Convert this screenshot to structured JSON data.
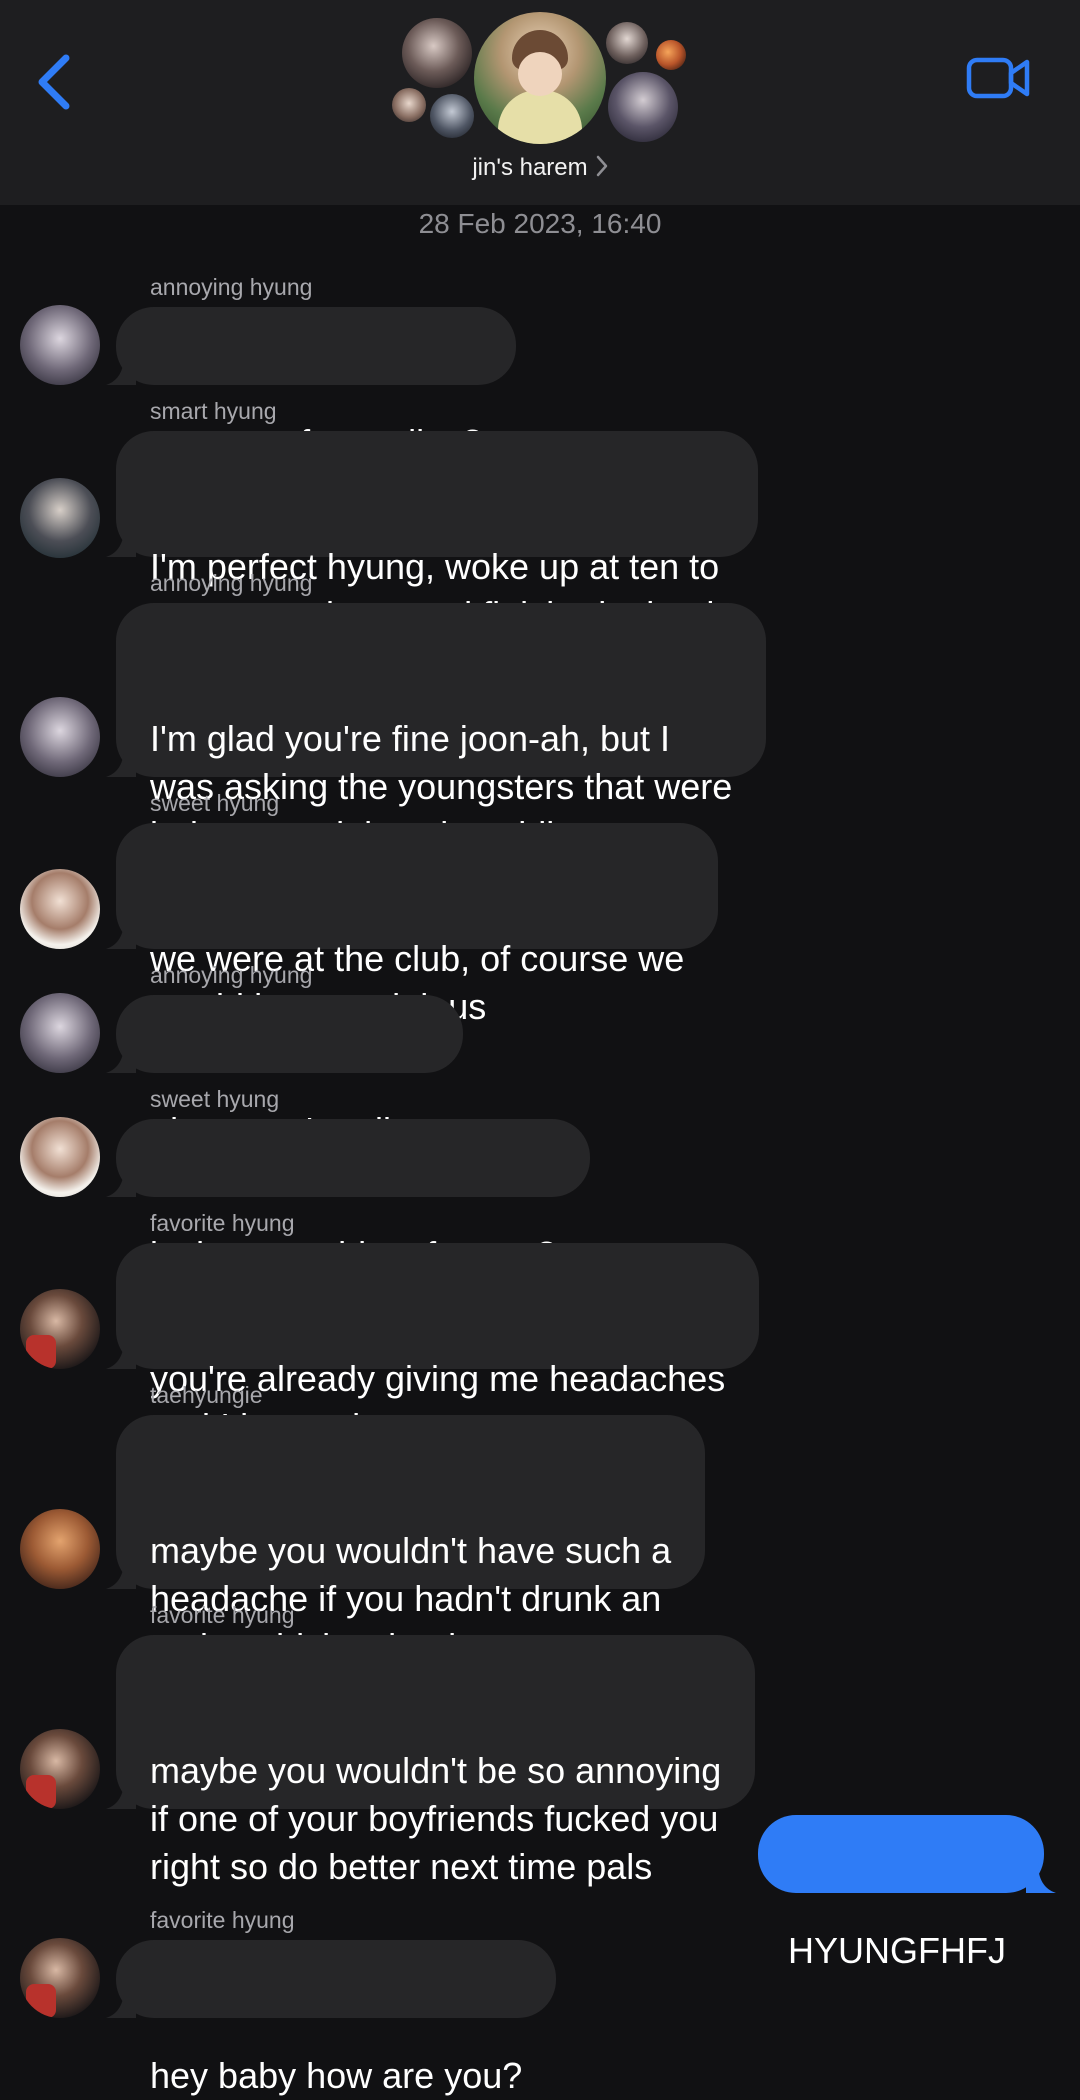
{
  "header": {
    "group_name": "jin's harem",
    "colors": {
      "accent": "#2f7cf6",
      "background": "#1e1e20"
    },
    "icons": {
      "back": "chevron-left-icon",
      "video": "video-camera-icon",
      "group_chevron": "chevron-right-icon"
    }
  },
  "timestamp": "28 Feb 2023, 16:40",
  "messages": [
    {
      "sender": "annoying hyung",
      "text": "are any of you alive?"
    },
    {
      "sender": "smart hyung",
      "text": "I'm perfect hyung, woke up at ten to\nwater my plants and finished a book"
    },
    {
      "sender": "annoying hyung",
      "text": "I'm glad you're fine joon-ah, but I\nwas asking the youngsters that were\nbeing scandalous in public spaces"
    },
    {
      "sender": "sweet hyung",
      "text": "we were at the club, of course we\nwould be scandalous"
    },
    {
      "sender": "annoying hyung",
      "text": "oh so you're alive"
    },
    {
      "sender": "sweet hyung",
      "text": "is that a problem for you?"
    },
    {
      "sender": "favorite hyung",
      "text": "you're already giving me headaches\nand I just woke up"
    },
    {
      "sender": "taehyungie",
      "text": "maybe you wouldn't have such a\nheadache if you hadn't drunk an\nentire whiskey bottle"
    },
    {
      "sender": "favorite hyung",
      "text": "maybe you wouldn't be so annoying\nif one of your boyfriends fucked you\nright so do better next time pals"
    },
    {
      "sender": "",
      "text": "HYUNGFHFJ"
    },
    {
      "sender": "favorite hyung",
      "text": "hey baby how are you?"
    }
  ],
  "colors": {
    "incoming_bubble": "#262628",
    "outgoing_bubble": "#2f7cf6",
    "sender_label": "#a8a8ad",
    "timestamp": "#8e8e93"
  }
}
